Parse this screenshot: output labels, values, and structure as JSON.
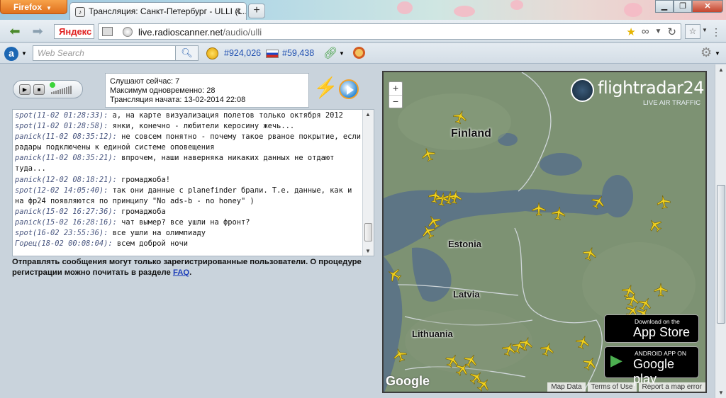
{
  "browser": {
    "app_button": "Firefox",
    "tab_title": "Трансляция: Санкт-Петербург - ULLI (L...",
    "yandex_label": "Яндекс",
    "url_host": "live.radioscanner.net",
    "url_path": "/audio/ulli",
    "search_placeholder": "Web Search",
    "rank_world": "#924,026",
    "rank_ru": "#59,438"
  },
  "stats": {
    "listeners_now": "Слушают сейчас: 7",
    "max_simultaneous": "Максимум одновременно: 28",
    "started": "Трансляция начата: 13-02-2014 22:08"
  },
  "chat": {
    "messages": [
      {
        "who": "spot(11-02 01:28:33):",
        "text": " а, на карте визуализация полетов только октября 2012"
      },
      {
        "who": "spot(11-02 01:28:58):",
        "text": " янки, конечно - любители керосину жечь..."
      },
      {
        "who": "panick(11-02 08:35:12):",
        "text": " не совсем понятно - почему такое рваное покрытие, если радары подключены к единой системе оповещения"
      },
      {
        "who": "panick(11-02 08:35:21):",
        "text": " впрочем, наши наверняка никаких данных не отдают туда..."
      },
      {
        "who": "panick(12-02 08:18:21):",
        "text": " громаджоба!"
      },
      {
        "who": "spot(12-02 14:05:40):",
        "text": " так они данные с planefinder брали. Т.е. данные, как и на фр24 появляются по принципу \"No ads-b - no honey\" )"
      },
      {
        "who": "panick(15-02 16:27:36):",
        "text": " громаджоба"
      },
      {
        "who": "panick(15-02 16:28:16):",
        "text": " чат вымер? все ушли на фронт?"
      },
      {
        "who": "spot(16-02 23:55:36):",
        "text": " все ушли на олимпиаду"
      },
      {
        "who": "Горец(18-02 00:08:04):",
        "text": " всем доброй ночи"
      }
    ],
    "notice": "Отправлять сообщения могут только зарегистрированные пользователи. О процедуре регистрации можно почитать в разделе ",
    "notice_link": "FAQ",
    "notice_end": "."
  },
  "map": {
    "logo_name": "flightradar24",
    "logo_tag": "LIVE AIR TRAFFIC",
    "labels": {
      "finland": "Finland",
      "estonia": "Estonia",
      "latvia": "Latvia",
      "lithuania": "Lithuania"
    },
    "appstore_small": "Download on the",
    "appstore_big": "App Store",
    "android_small": "ANDROID APP ON",
    "android_big": "Google play",
    "google": "Google",
    "footer": [
      "Map Data",
      "Terms of Use",
      "Report a map error"
    ]
  }
}
